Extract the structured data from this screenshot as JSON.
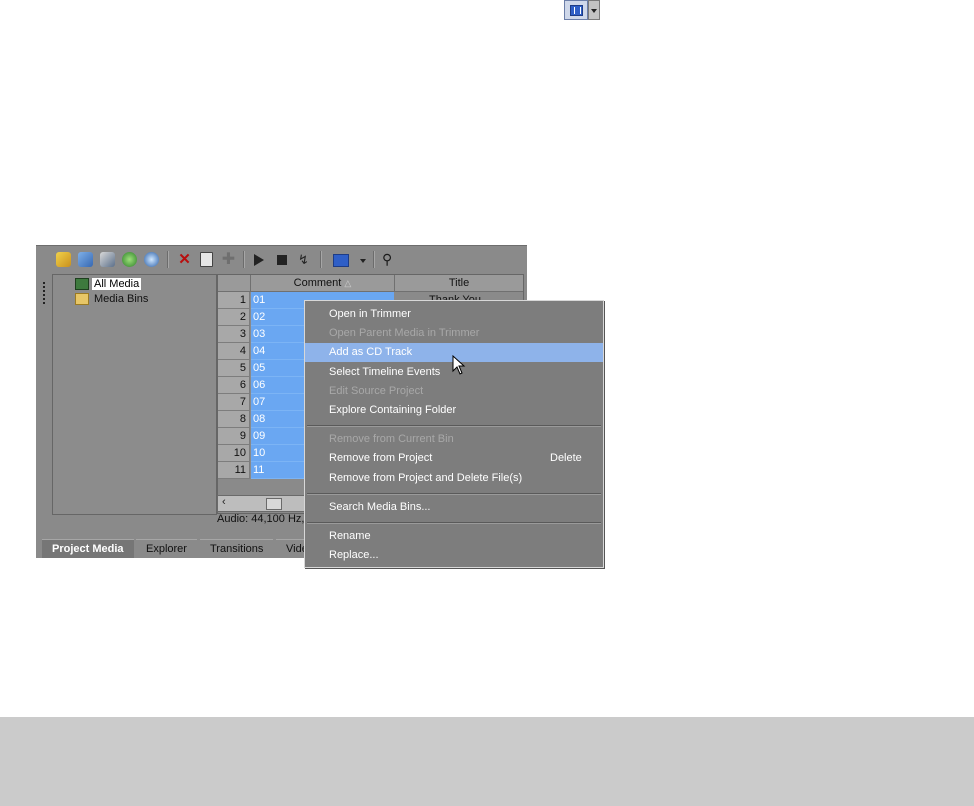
{
  "top_button": {
    "icon": "view-grid-icon",
    "dropdown_icon": "chevron-down-icon"
  },
  "toolbar": {
    "icons": [
      "import-media-icon",
      "capture-video-icon",
      "get-media-web-icon",
      "refresh-icon",
      "search-media-icon",
      "remove-icon",
      "properties-icon",
      "add-effect-icon",
      "play-icon",
      "stop-icon",
      "auto-preview-icon",
      "views-icon",
      "views-dropdown-icon",
      "search-icon"
    ]
  },
  "tree": {
    "items": [
      {
        "label": "All Media",
        "icon": "all-media-icon"
      },
      {
        "label": "Media Bins",
        "icon": "folder-icon"
      }
    ]
  },
  "grid": {
    "columns": [
      "Comment",
      "Title"
    ],
    "sort_indicator": "sort-ascending-icon",
    "rows": [
      {
        "num": "1",
        "comment": "01",
        "title": "Thank You"
      },
      {
        "num": "2",
        "comment": "02"
      },
      {
        "num": "3",
        "comment": "03"
      },
      {
        "num": "4",
        "comment": "04"
      },
      {
        "num": "5",
        "comment": "05"
      },
      {
        "num": "6",
        "comment": "06"
      },
      {
        "num": "7",
        "comment": "07"
      },
      {
        "num": "8",
        "comment": "08"
      },
      {
        "num": "9",
        "comment": "09"
      },
      {
        "num": "10",
        "comment": "10"
      },
      {
        "num": "11",
        "comment": "11"
      }
    ],
    "scroll_left": "‹"
  },
  "status": "Audio: 44,100 Hz,",
  "tabs": [
    "Project Media",
    "Explorer",
    "Transitions",
    "Vide"
  ],
  "context_menu": {
    "items": [
      {
        "label": "Open in Trimmer",
        "enabled": true
      },
      {
        "label": "Open Parent Media in Trimmer",
        "enabled": false
      },
      {
        "label": "Add as CD Track",
        "enabled": true,
        "highlighted": true
      },
      {
        "label": "Select Timeline Events",
        "enabled": true
      },
      {
        "label": "Edit Source Project",
        "enabled": false
      },
      {
        "label": "Explore Containing Folder",
        "enabled": true
      },
      {
        "label": "Remove from Current Bin",
        "enabled": false
      },
      {
        "label": "Remove from Project",
        "enabled": true,
        "shortcut": "Delete"
      },
      {
        "label": "Remove from Project and Delete File(s)",
        "enabled": true
      },
      {
        "label": "Search Media Bins...",
        "enabled": true
      },
      {
        "label": "Rename",
        "enabled": true
      },
      {
        "label": "Replace...",
        "enabled": true
      }
    ]
  },
  "colors": {
    "selection": "#6aa7f2",
    "menu_highlight": "#8eb3ea",
    "panel": "#8a8a8a",
    "footer": "#cbcbcb"
  }
}
